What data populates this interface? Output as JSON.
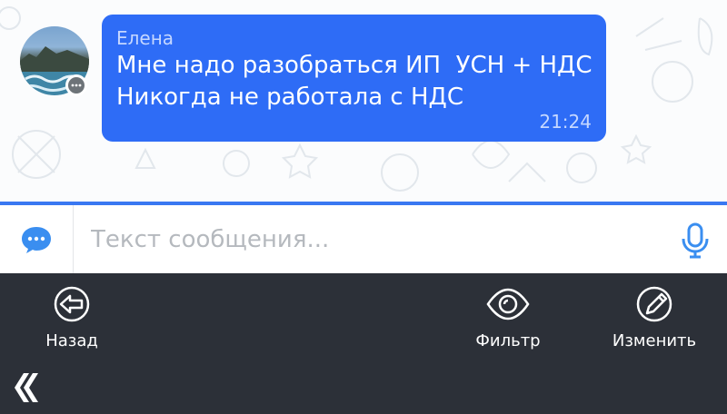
{
  "message": {
    "sender": "Елена",
    "lines": [
      "Мне надо разобраться ИП  УСН + НДС",
      "Никогда не работала с НДС"
    ],
    "time": "21:24"
  },
  "composer": {
    "placeholder": "Текст сообщения...",
    "left_icon": "chat-bubble-icon",
    "right_icon": "microphone-icon"
  },
  "toolbar": {
    "back_label": "Назад",
    "filter_label": "Фильтр",
    "edit_label": "Изменить"
  },
  "colors": {
    "bubble": "#2e6cf6",
    "accent": "#3a78f2",
    "toolbar_bg": "#2c3038"
  }
}
